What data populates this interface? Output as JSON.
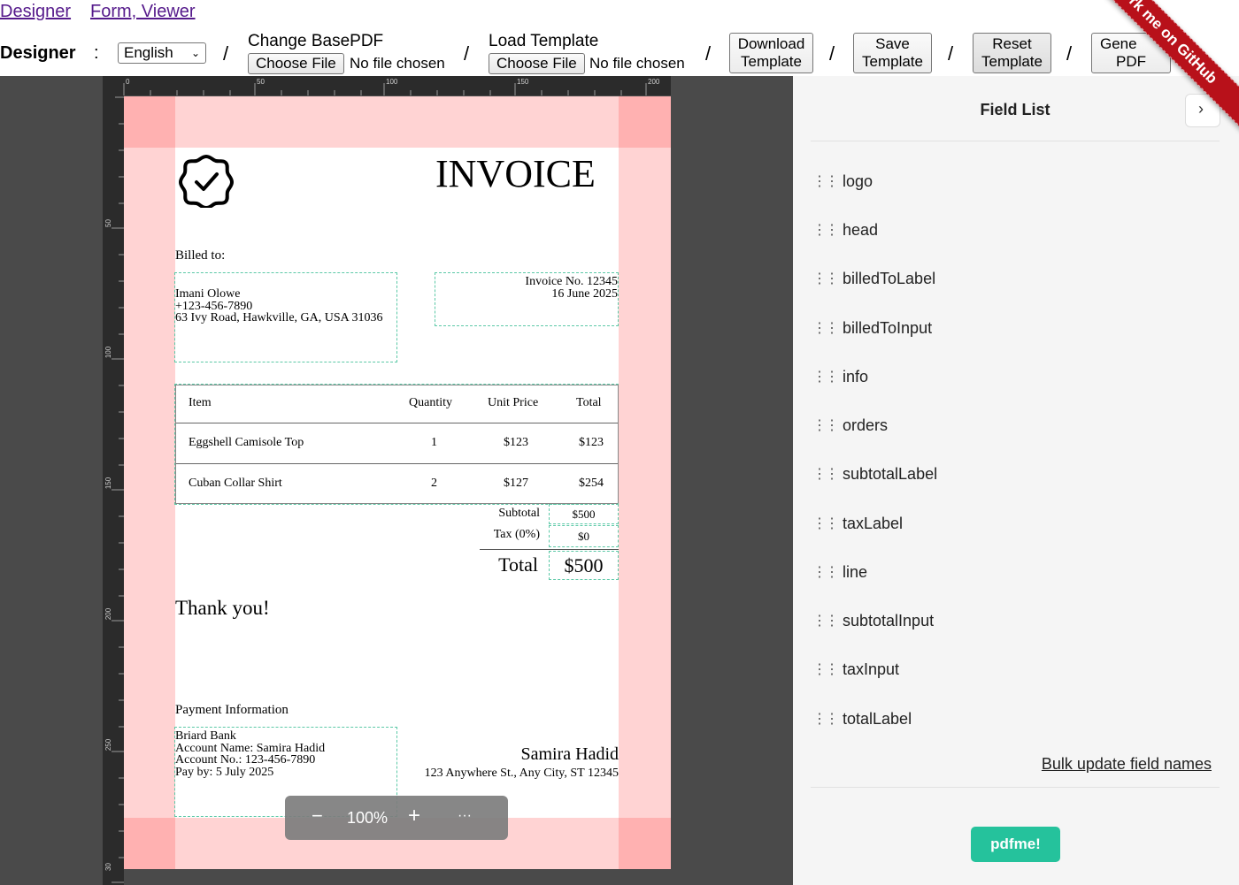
{
  "nav": {
    "designer": "Designer",
    "form_viewer": "Form, Viewer"
  },
  "toolbar": {
    "title": "Designer",
    "colon": ":",
    "language": "English",
    "sep": "/",
    "change_basepdf_label": "Change BasePDF",
    "load_template_label": "Load Template",
    "choose_file": "Choose File",
    "no_file": "No file chosen",
    "download_template_l1": "Download",
    "download_template_l2": "Template",
    "save_template_l1": "Save",
    "save_template_l2": "Template",
    "reset_template_l1": "Reset",
    "reset_template_l2": "Template",
    "generate_pdf_l1": "Gene",
    "generate_pdf_l2": "PDF"
  },
  "ribbon": "Fork me on GitHub",
  "ruler": {
    "h": [
      "0",
      "50",
      "100",
      "150",
      "200"
    ],
    "v": [
      "50",
      "100",
      "150",
      "200",
      "250",
      "30"
    ]
  },
  "invoice": {
    "head": "INVOICE",
    "billed_to_label": "Billed to:",
    "billed_to_lines": [
      "Imani Olowe",
      "+123-456-7890",
      "63 Ivy Road, Hawkville, GA, USA 31036"
    ],
    "info_lines": [
      "Invoice No. 12345",
      "16 June 2025"
    ],
    "table": {
      "headers": [
        "Item",
        "Quantity",
        "Unit Price",
        "Total"
      ],
      "rows": [
        [
          "Eggshell Camisole Top",
          "1",
          "$123",
          "$123"
        ],
        [
          "Cuban Collar Shirt",
          "2",
          "$127",
          "$254"
        ]
      ]
    },
    "subtotal_label": "Subtotal",
    "subtotal_value": "$500",
    "tax_label": "Tax (0%)",
    "tax_value": "$0",
    "total_label": "Total",
    "total_value": "$500",
    "thank_you": "Thank you!",
    "payment_label": "Payment Information",
    "payment_lines": [
      "Briard Bank",
      "Account Name: Samira Hadid",
      "Account No.: 123-456-7890",
      "Pay by: 5 July 2025"
    ],
    "sender_name": "Samira Hadid",
    "sender_address": "123 Anywhere St., Any City, ST 12345"
  },
  "zoom": {
    "minus": "−",
    "level": "100%",
    "plus": "+",
    "more": "···"
  },
  "panel": {
    "title": "Field List",
    "fields": [
      "logo",
      "head",
      "billedToLabel",
      "billedToInput",
      "info",
      "orders",
      "subtotalLabel",
      "taxLabel",
      "line",
      "subtotalInput",
      "taxInput",
      "totalLabel"
    ],
    "bulk_update": "Bulk update field names",
    "pdfme_button": "pdfme!"
  },
  "colors": {
    "accent": "#25c29c",
    "ribbon": "#b8111a",
    "padding": "#ffd3d3",
    "field_border": "#5cc9a7"
  },
  "icons": {
    "logo": "badge-check-icon",
    "drag": "drag-handle-icon",
    "close": "chevron-right-icon"
  }
}
